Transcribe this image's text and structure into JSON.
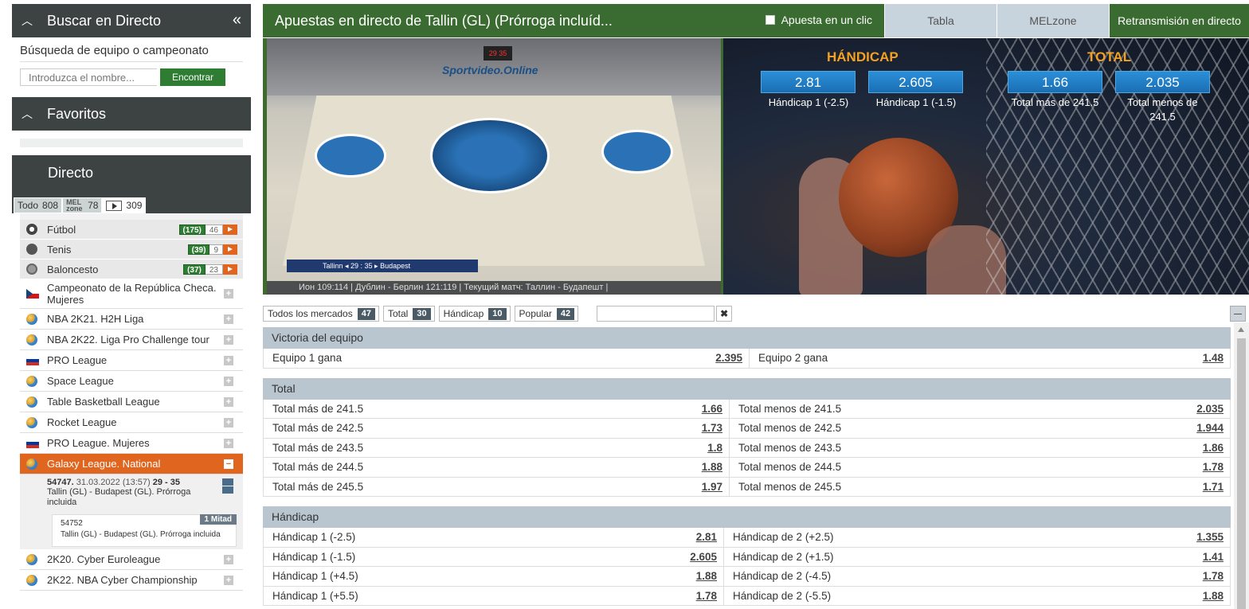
{
  "sidebar": {
    "search_header": "Buscar en Directo",
    "search_label": "Búsqueda de equipo o campeonato",
    "search_placeholder": "Introduzca el nombre...",
    "search_button": "Encontrar",
    "favorites_header": "Favoritos",
    "directo_header": "Directo",
    "tabs": [
      {
        "label": "Todo",
        "count": "808"
      },
      {
        "label": "MEL zone",
        "count": "78"
      },
      {
        "label": "▶",
        "count": "309"
      }
    ],
    "sports": [
      {
        "name": "Fútbol",
        "live": "(175)",
        "video": "46"
      },
      {
        "name": "Tenis",
        "live": "(39)",
        "video": "9"
      },
      {
        "name": "Baloncesto",
        "live": "(37)",
        "video": "23"
      }
    ],
    "leagues": [
      {
        "name": "Campeonato de la República Checa. Mujeres",
        "flag": "cz"
      },
      {
        "name": "NBA 2K21. H2H Liga",
        "flag": "globe"
      },
      {
        "name": "NBA 2K22. Liga Pro Challenge tour",
        "flag": "globe"
      },
      {
        "name": "PRO League",
        "flag": "ru"
      },
      {
        "name": "Space League",
        "flag": "globe"
      },
      {
        "name": "Table Basketball League",
        "flag": "globe"
      },
      {
        "name": "Rocket League",
        "flag": "globe"
      },
      {
        "name": "PRO League. Mujeres",
        "flag": "ru"
      },
      {
        "name": "Galaxy League. National",
        "flag": "globe",
        "active": true
      }
    ],
    "match": {
      "id": "54747.",
      "date": "31.03.2022 (13:57)",
      "score": "29 - 35",
      "teams": "Tallin (GL) - Budapest (GL). Prórroga incluida",
      "sub_id": "54752",
      "sub_teams": "Tallin (GL) - Budapest (GL). Prórroga incluida",
      "sub_badge": "1 Mitad"
    },
    "leagues_after": [
      {
        "name": "2K20. Cyber Euroleague",
        "flag": "globe"
      },
      {
        "name": "2K22. NBA Cyber Championship",
        "flag": "globe"
      }
    ]
  },
  "main": {
    "title": "Apuestas en directo de Tallin (GL) (Prórroga incluíd...",
    "one_click": "Apuesta en un clic",
    "tabs": [
      "Tabla",
      "MELzone",
      "Retransmisión en directo"
    ],
    "video_ticker": "Ион 109:114 | Дублин - Берлин 121:119 | Текущий матч: Таллин - Будапешт |",
    "video_overlay": "Tallinn ◂ 29 : 35 ▸ Budapest",
    "video_brand": "Sportvideo.Online",
    "video_scoreboard": "29 35",
    "hero": {
      "handicap_title": "HÁNDICAP",
      "total_title": "TOTAL",
      "odds": [
        {
          "value": "2.81",
          "label": "Hándicap 1 (-2.5)"
        },
        {
          "value": "2.605",
          "label": "Hándicap 1 (-1.5)"
        },
        {
          "value": "1.66",
          "label": "Total más de 241.5"
        },
        {
          "value": "2.035",
          "label": "Total menos de 241.5"
        }
      ]
    },
    "filters": [
      {
        "label": "Todos los mercados",
        "count": "47"
      },
      {
        "label": "Total",
        "count": "30"
      },
      {
        "label": "Hándicap",
        "count": "10"
      },
      {
        "label": "Popular",
        "count": "42"
      }
    ],
    "markets": {
      "winner": {
        "title": "Victoria del equipo",
        "rows": [
          {
            "l": "Equipo 1 gana",
            "lv": "2.395",
            "r": "Equipo 2 gana",
            "rv": "1.48"
          }
        ]
      },
      "total": {
        "title": "Total",
        "rows": [
          {
            "l": "Total más de 241.5",
            "lv": "1.66",
            "r": "Total menos de 241.5",
            "rv": "2.035"
          },
          {
            "l": "Total más de 242.5",
            "lv": "1.73",
            "r": "Total menos de 242.5",
            "rv": "1.944"
          },
          {
            "l": "Total más de 243.5",
            "lv": "1.8",
            "r": "Total menos de 243.5",
            "rv": "1.86"
          },
          {
            "l": "Total más de 244.5",
            "lv": "1.88",
            "r": "Total menos de 244.5",
            "rv": "1.78"
          },
          {
            "l": "Total más de 245.5",
            "lv": "1.97",
            "r": "Total menos de 245.5",
            "rv": "1.71"
          }
        ]
      },
      "handicap": {
        "title": "Hándicap",
        "rows": [
          {
            "l": "Hándicap 1 (-2.5)",
            "lv": "2.81",
            "r": "Hándicap de 2 (+2.5)",
            "rv": "1.355"
          },
          {
            "l": "Hándicap 1 (-1.5)",
            "lv": "2.605",
            "r": "Hándicap de 2 (+1.5)",
            "rv": "1.41"
          },
          {
            "l": "Hándicap 1 (+4.5)",
            "lv": "1.88",
            "r": "Hándicap de 2 (-4.5)",
            "rv": "1.78"
          },
          {
            "l": "Hándicap 1 (+5.5)",
            "lv": "1.78",
            "r": "Hándicap de 2 (-5.5)",
            "rv": "1.88"
          }
        ]
      }
    }
  }
}
